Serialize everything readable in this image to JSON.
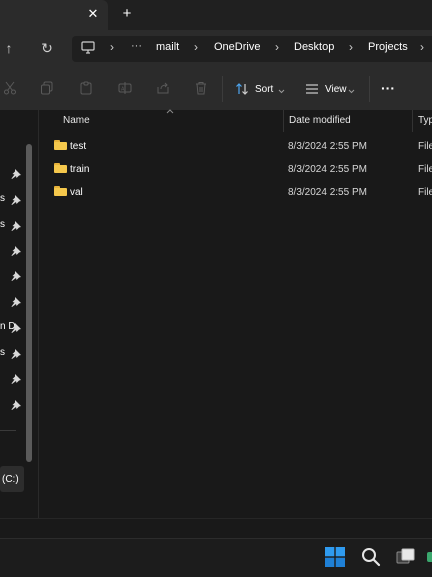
{
  "titlebar": {
    "close_glyph": "✕",
    "newtab_glyph": "+"
  },
  "nav": {
    "up_glyph": "↑",
    "refresh_glyph": "↻"
  },
  "breadcrumb": {
    "items": [
      {
        "label": "mailt"
      },
      {
        "label": "OneDrive"
      },
      {
        "label": "Desktop"
      },
      {
        "label": "Projects"
      }
    ],
    "overflow": "···",
    "separator": "›"
  },
  "toolbar": {
    "sort_label": "Sort",
    "view_label": "View",
    "more_glyph": "···"
  },
  "columns": {
    "name": "Name",
    "date": "Date modified",
    "type": "Typ"
  },
  "files": [
    {
      "name": "test",
      "date": "8/3/2024 2:55 PM",
      "type": "File"
    },
    {
      "name": "train",
      "date": "8/3/2024 2:55 PM",
      "type": "File"
    },
    {
      "name": "val",
      "date": "8/3/2024 2:55 PM",
      "type": "File"
    }
  ],
  "navpane": {
    "partial_labels": [
      "s",
      "s",
      "n D",
      "s"
    ],
    "drive_label": "(C:)"
  },
  "colors": {
    "accent": "#0078d4",
    "folder": "#f5c84c",
    "background": "#191919"
  }
}
